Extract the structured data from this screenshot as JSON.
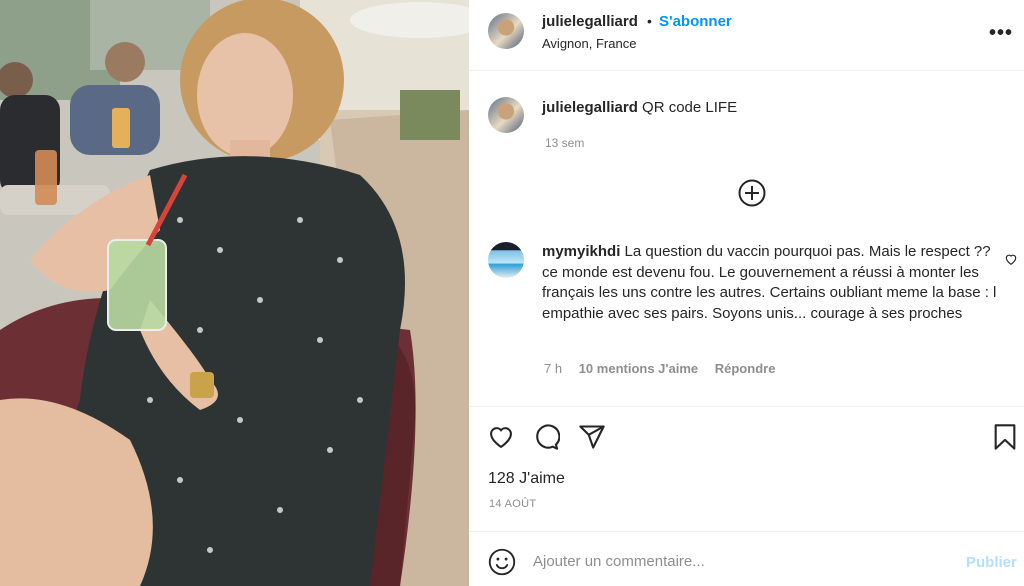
{
  "post": {
    "username": "julielegalliard",
    "follow_label": "S'abonner",
    "location": "Avignon, France",
    "more_label": "•••",
    "caption_text": "QR code LIFE",
    "caption_time": "13 sem"
  },
  "comment": {
    "username": "mymyikhdi",
    "text": "La question du vaccin pourquoi pas. Mais le respect ??ce monde est devenu fou. Le gouvernement a réussi à monter les français les uns contre les autres. Certains oubliant meme la base : l empathie avec ses pairs. Soyons unis... courage à ses proches",
    "time": "7 h",
    "likes": "10 mentions J'aime",
    "reply_label": "Répondre"
  },
  "actions": {
    "likes_count": "128 J'aime",
    "date": "14 AOÛT"
  },
  "add_comment": {
    "placeholder": "Ajouter un commentaire...",
    "publish_label": "Publier"
  },
  "colors": {
    "accent": "#0095f6",
    "publish_disabled": "#b2dffc",
    "text": "#262626",
    "muted": "#8e8e8e"
  },
  "icons": [
    "heart-icon",
    "comment-icon",
    "share-icon",
    "bookmark-icon",
    "add-icon",
    "emoji-icon",
    "more-icon"
  ]
}
